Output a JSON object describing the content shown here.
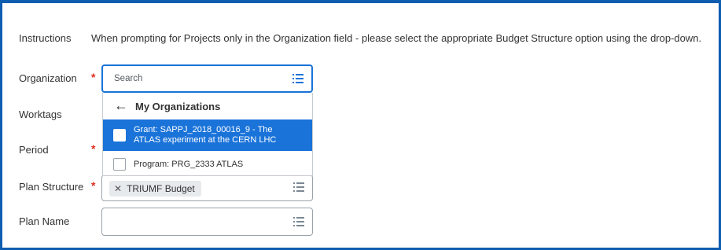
{
  "instructions": {
    "label": "Instructions",
    "text": "When prompting for Projects only in the Organization field - please select the appropriate Budget Structure option using the drop-down."
  },
  "fields": {
    "organization": {
      "label": "Organization",
      "required": true,
      "placeholder": "Search"
    },
    "worktags": {
      "label": "Worktags",
      "required": false
    },
    "period": {
      "label": "Period",
      "required": true
    },
    "plan_structure": {
      "label": "Plan Structure",
      "required": true,
      "selected_value": "TRIUMF Budget"
    },
    "plan_name": {
      "label": "Plan Name",
      "required": false,
      "value": ""
    }
  },
  "dropdown": {
    "back_icon": "arrow-left-icon",
    "title": "My Organizations",
    "items": [
      {
        "label_line1": "Grant: SAPPJ_2018_00016_9 - The",
        "label_line2": "ATLAS experiment at the CERN LHC",
        "selected": true
      },
      {
        "label_line1": "Program: PRG_2333 ATLAS",
        "label_line2": "",
        "selected": false
      }
    ]
  },
  "icons": {
    "prompt": "prompt-list-icon",
    "remove": "x-icon"
  },
  "colors": {
    "accent": "#1a73d9",
    "frame": "#0d5db0",
    "required": "#de2e21"
  }
}
